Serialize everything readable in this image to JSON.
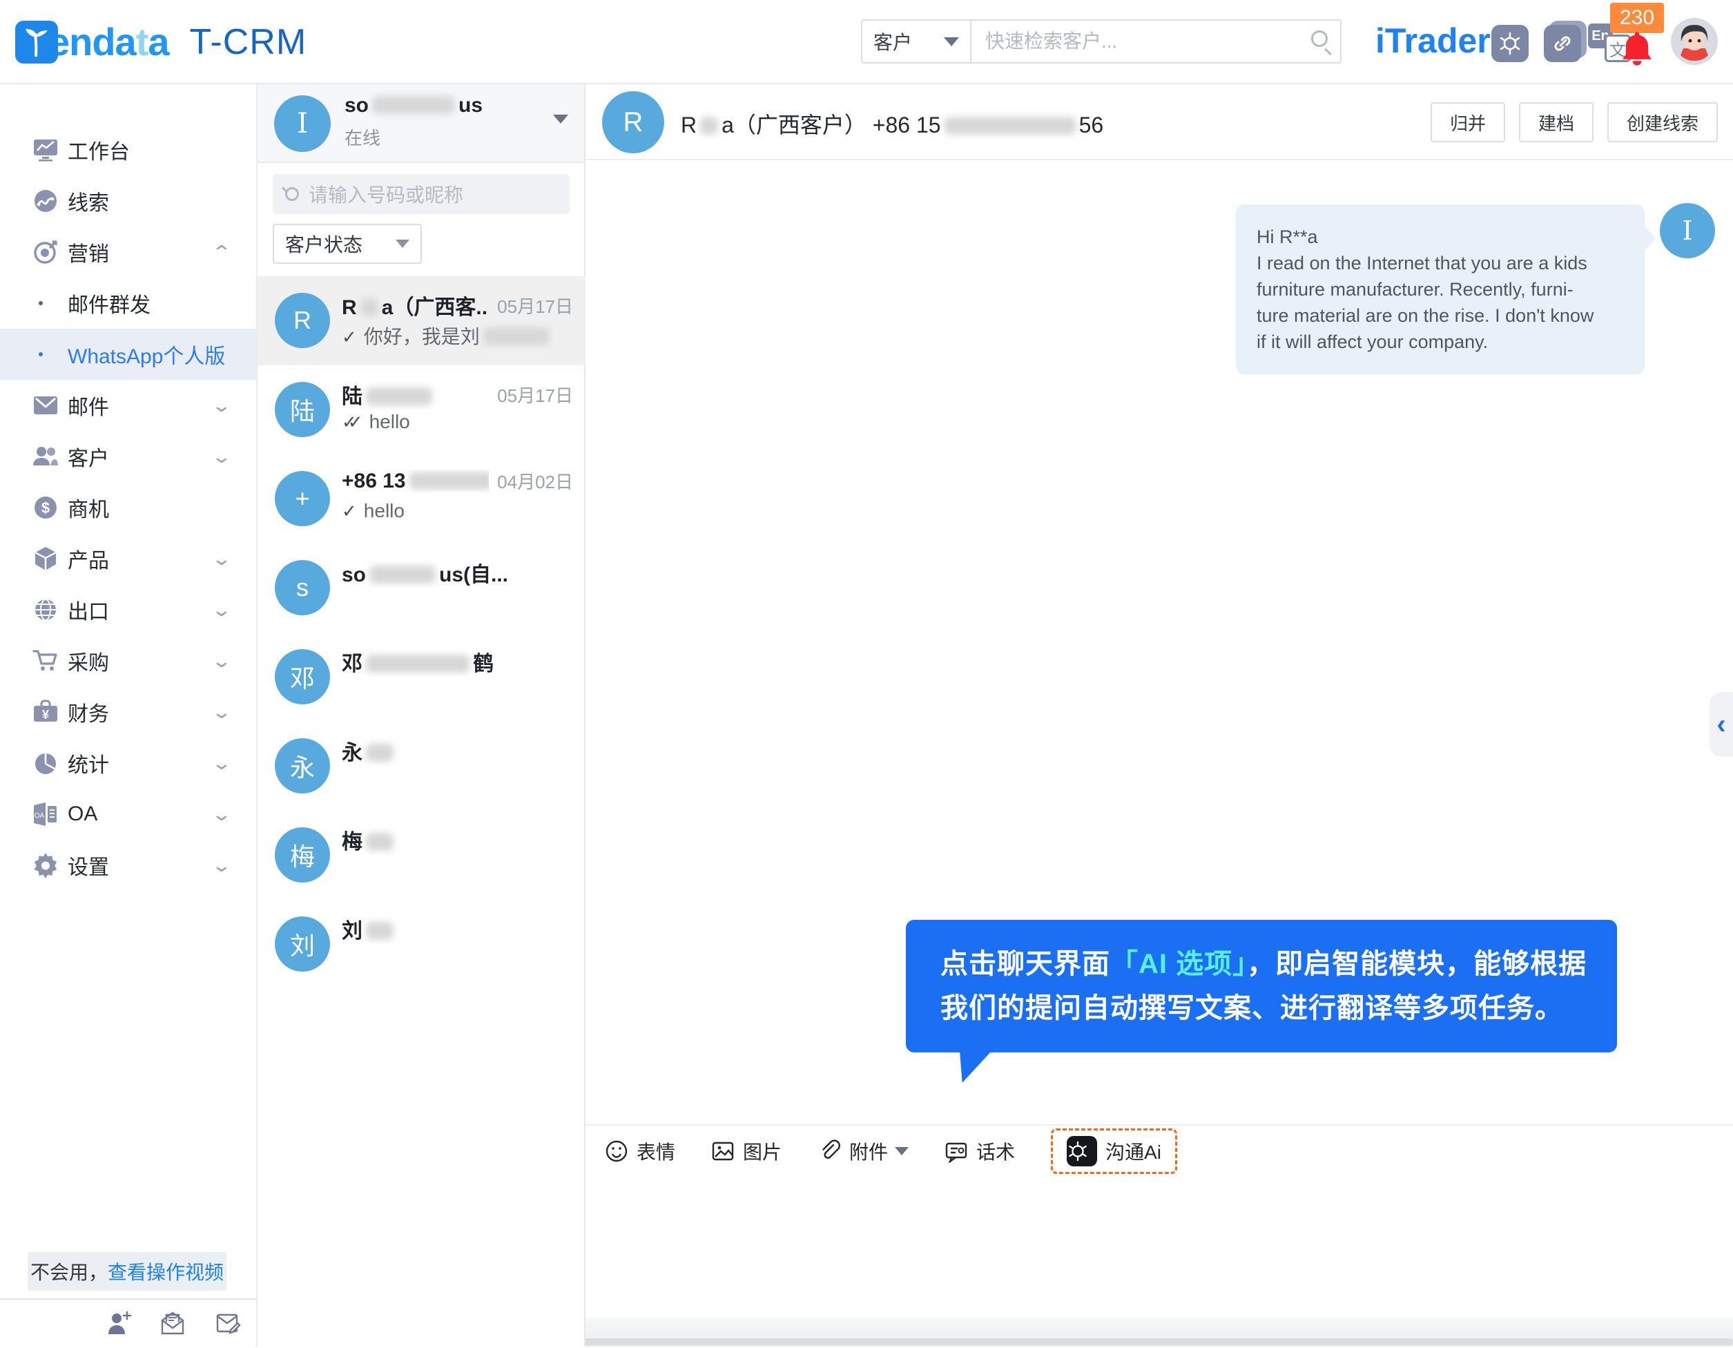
{
  "colors": {
    "accent_blue": "#1E80F5",
    "callout_blue": "#1B6FF2",
    "callout_accent_cyan": "#59EFE2",
    "avatar_blue": "#58A9DE",
    "badge_orange": "#FF8A3B",
    "bell_red": "#F5222D",
    "dashed_highlight_orange": "#F06A1D",
    "selected_row_gray": "#F0F0F0",
    "selected_nav_bg": "#E9EDF6"
  },
  "header": {
    "logo_word_parts": [
      {
        "text": "enda"
      },
      {
        "text": "t",
        "cyan": true
      },
      {
        "text": "a"
      }
    ],
    "product_name": "T-CRM",
    "search": {
      "category": "客户",
      "placeholder": "快速检索客户..."
    },
    "right_brand": "iTrader",
    "notification_count": "230",
    "icons": [
      "gpt-icon",
      "link-icon",
      "translate-icon",
      "bell-icon",
      "user-avatar"
    ]
  },
  "sidebar": {
    "items": [
      {
        "label": "工作台",
        "icon": "workbench"
      },
      {
        "label": "线索",
        "icon": "leads"
      },
      {
        "label": "营销",
        "icon": "marketing",
        "chevron": "up"
      },
      {
        "label": "邮件群发",
        "sub": true
      },
      {
        "label": "WhatsApp个人版",
        "sub": true,
        "selected": true
      },
      {
        "label": "邮件",
        "icon": "mail",
        "chevron": "down"
      },
      {
        "label": "客户",
        "icon": "customers",
        "chevron": "down"
      },
      {
        "label": "商机",
        "icon": "opportunity"
      },
      {
        "label": "产品",
        "icon": "products",
        "chevron": "down"
      },
      {
        "label": "出口",
        "icon": "export",
        "chevron": "down"
      },
      {
        "label": "采购",
        "icon": "procurement",
        "chevron": "down"
      },
      {
        "label": "财务",
        "icon": "finance",
        "chevron": "down"
      },
      {
        "label": "统计",
        "icon": "statistics",
        "chevron": "down"
      },
      {
        "label": "OA",
        "icon": "oa",
        "chevron": "down"
      },
      {
        "label": "设置",
        "icon": "settings",
        "chevron": "down"
      }
    ],
    "footer": {
      "help_prefix": "不会用，",
      "help_link": "查看操作视频",
      "footer_icons": [
        "add-contact-icon",
        "open-mail-icon",
        "compose-mail-icon"
      ]
    }
  },
  "chat_list": {
    "account": {
      "initial": "I",
      "name_parts": [
        {
          "text": "so"
        },
        {
          "blur": 120
        },
        {
          "text": "us"
        }
      ],
      "status": "在线"
    },
    "search_placeholder": "请输入号码或昵称",
    "status_filter_label": "客户状态",
    "items": [
      {
        "initial": "R",
        "selected": true,
        "date": "05月17日",
        "check": "single",
        "name_parts": [
          {
            "text": "R"
          },
          {
            "blur": 26
          },
          {
            "text": "a（广西客..."
          }
        ],
        "msg_parts": [
          {
            "text": "你好，我是刘"
          },
          {
            "blur": 96
          }
        ]
      },
      {
        "initial": "陆",
        "date": "05月17日",
        "check": "double",
        "name_parts": [
          {
            "text": "陆"
          },
          {
            "blur": 96
          }
        ],
        "msg_parts": [
          {
            "text": "hello"
          }
        ]
      },
      {
        "initial": "+",
        "date": "04月02日",
        "check": "single",
        "name_parts": [
          {
            "text": "+86 13"
          },
          {
            "blur": 120
          },
          {
            "text": "..."
          }
        ],
        "msg_parts": [
          {
            "text": "hello"
          }
        ]
      },
      {
        "initial": "s",
        "name_parts": [
          {
            "text": "so"
          },
          {
            "blur": 96
          },
          {
            "text": "us(自..."
          }
        ]
      },
      {
        "initial": "邓",
        "name_parts": [
          {
            "text": "邓"
          },
          {
            "blur": 150
          },
          {
            "text": "鹤"
          }
        ]
      },
      {
        "initial": "永",
        "name_parts": [
          {
            "text": "永"
          },
          {
            "blur": 40
          }
        ]
      },
      {
        "initial": "梅",
        "name_parts": [
          {
            "text": "梅"
          },
          {
            "blur": 40
          }
        ]
      },
      {
        "initial": "刘",
        "name_parts": [
          {
            "text": "刘"
          },
          {
            "blur": 40
          }
        ]
      }
    ]
  },
  "chat": {
    "header": {
      "initial": "R",
      "title_parts": [
        {
          "text": "R"
        },
        {
          "blur": 26
        },
        {
          "text": "a（广西客户） +86 15"
        },
        {
          "blur": 190
        },
        {
          "text": "56"
        }
      ],
      "buttons": [
        "归并",
        "建档",
        "创建线索"
      ]
    },
    "message": {
      "avatar_initial": "I",
      "lines": [
        "Hi R**a",
        "I read on the Internet that you are a kids",
        "furniture manufacturer. Recently, furni-",
        "ture material are on the rise. I don't know",
        "if it will affect your company."
      ]
    },
    "callout_segments": [
      {
        "text": "点击聊天界面"
      },
      {
        "text": "「AI 选项」",
        "accent": true
      },
      {
        "text": "，即启智能模块，能够根据"
      },
      {
        "br": true
      },
      {
        "text": "我们的提问自动撰写文案、进行翻译等多项任务。"
      }
    ],
    "toolbar": [
      {
        "label": "表情",
        "icon": "emoji"
      },
      {
        "label": "图片",
        "icon": "image"
      },
      {
        "label": "附件",
        "icon": "attachment",
        "caret": true
      },
      {
        "label": "话术",
        "icon": "scripts"
      },
      {
        "label": "沟通Ai",
        "icon": "gpt",
        "highlighted": true
      }
    ]
  },
  "edge_toggle_glyph": "‹"
}
